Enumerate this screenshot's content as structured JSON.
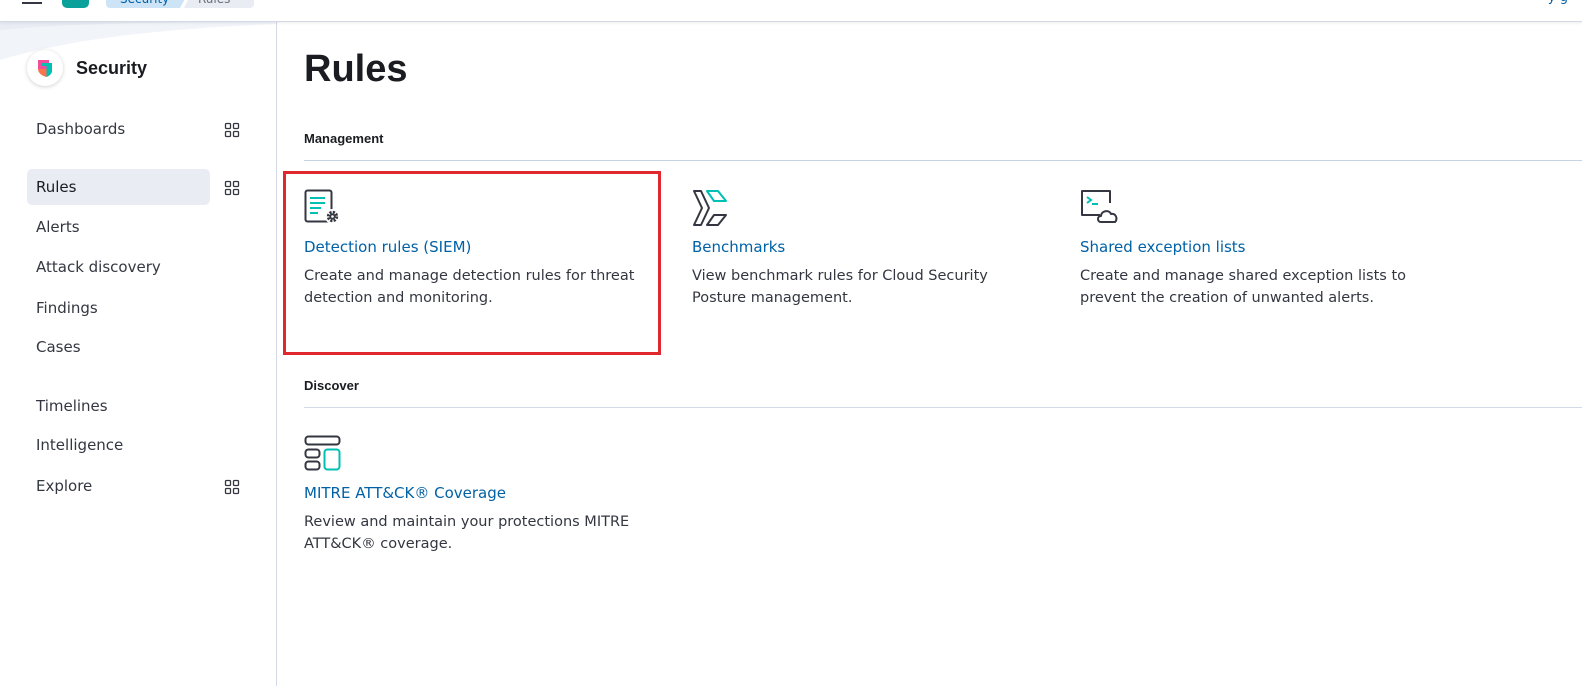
{
  "header": {
    "breadcrumbs": [
      "Security",
      "Rules"
    ],
    "right_text": "y   g"
  },
  "sidebar": {
    "brand": "Security",
    "items": [
      {
        "label": "Dashboards",
        "has_grid_icon": true
      },
      {
        "label": "Rules",
        "has_grid_icon": true,
        "active": true
      },
      {
        "label": "Alerts"
      },
      {
        "label": "Attack discovery"
      },
      {
        "label": "Findings"
      },
      {
        "label": "Cases"
      },
      {
        "label": "Timelines"
      },
      {
        "label": "Intelligence"
      },
      {
        "label": "Explore",
        "has_grid_icon": true
      }
    ]
  },
  "main": {
    "title": "Rules",
    "sections": [
      {
        "title": "Management",
        "cards": [
          {
            "title": "Detection rules (SIEM)",
            "description": "Create and manage detection rules for threat detection and monitoring.",
            "icon": "detection-rules-icon"
          },
          {
            "title": "Benchmarks",
            "description": "View benchmark rules for Cloud Security Posture management.",
            "icon": "benchmarks-icon"
          },
          {
            "title": "Shared exception lists",
            "description": "Create and manage shared exception lists to prevent the creation of unwanted alerts.",
            "icon": "exception-lists-icon"
          }
        ]
      },
      {
        "title": "Discover",
        "cards": [
          {
            "title": "MITRE ATT&CK® Coverage",
            "description": "Review and maintain your protections MITRE ATT&CK® coverage.",
            "icon": "mitre-coverage-icon"
          }
        ]
      }
    ]
  },
  "colors": {
    "link": "#0061a6",
    "accent_teal": "#00bfb3",
    "highlight": "#e0282e",
    "active_nav_bg": "#e9edf3"
  }
}
